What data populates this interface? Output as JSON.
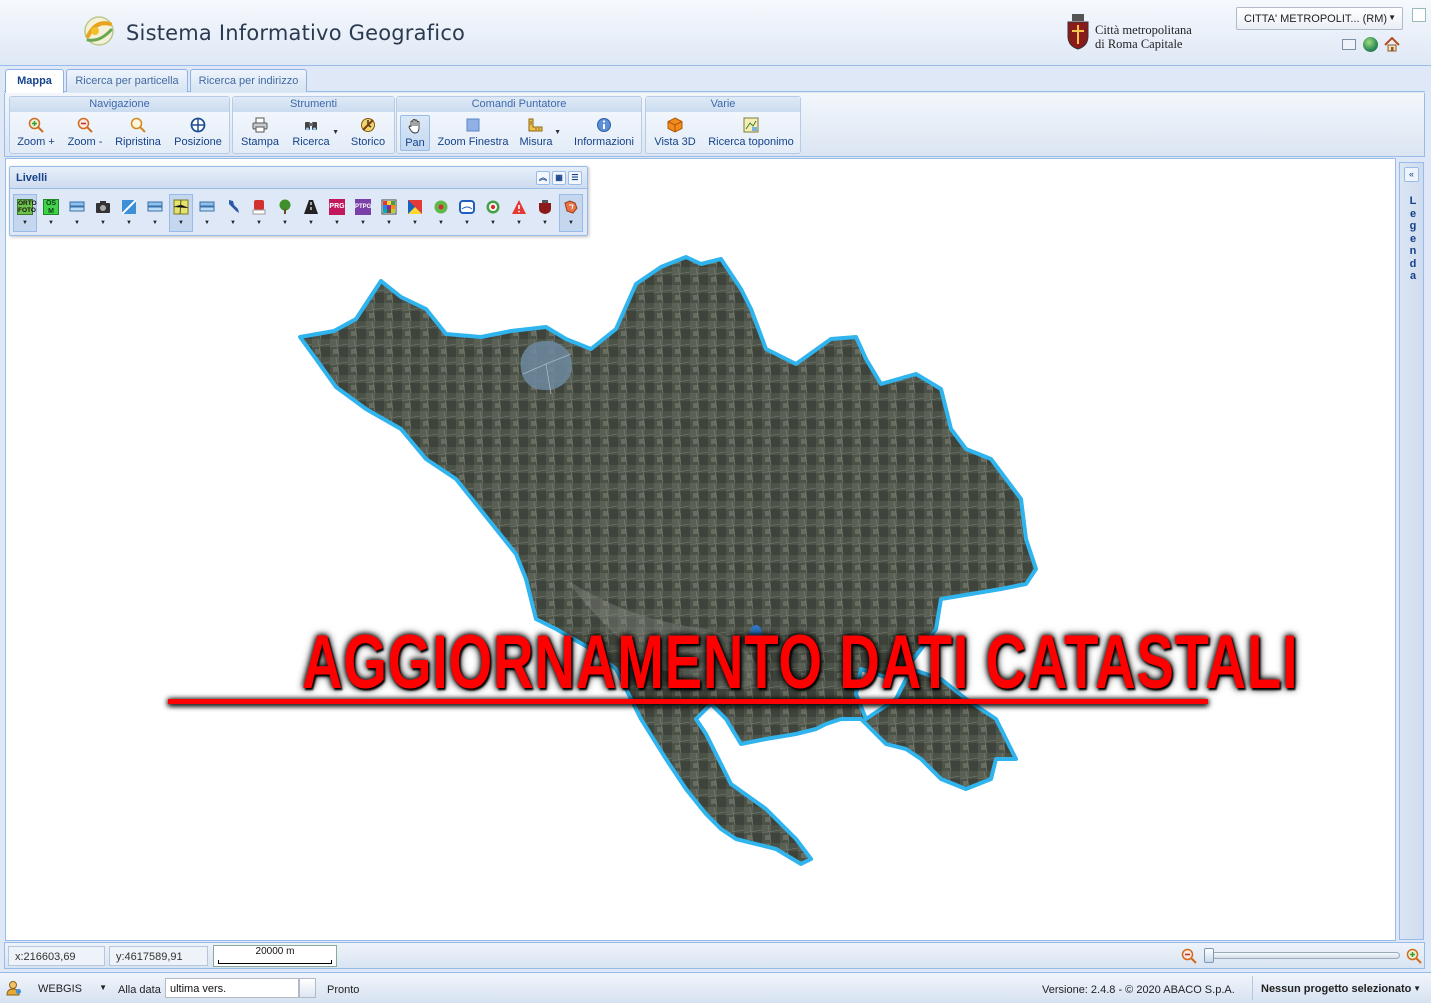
{
  "header": {
    "app_title": "Sistema Informativo Geografico",
    "org_name_line1": "Città metropolitana",
    "org_name_line2": "di Roma Capitale",
    "ente_selected": "CITTA' METROPOLIT... (RM)",
    "icons": [
      "mail-icon",
      "globe-icon",
      "home-icon",
      "maximize-icon"
    ]
  },
  "tabs": [
    {
      "label": "Mappa",
      "active": true
    },
    {
      "label": "Ricerca per particella",
      "active": false
    },
    {
      "label": "Ricerca per indirizzo",
      "active": false
    }
  ],
  "toolbar": {
    "groups": [
      {
        "title": "Navigazione",
        "buttons": [
          "Zoom +",
          "Zoom -",
          "Ripristina",
          "Posizione"
        ]
      },
      {
        "title": "Strumenti",
        "buttons": [
          "Stampa",
          "Ricerca",
          "Storico"
        ]
      },
      {
        "title": "Comandi Puntatore",
        "buttons": [
          "Pan",
          "Zoom Finestra",
          "Misura",
          "Informazioni"
        ]
      },
      {
        "title": "Varie",
        "buttons": [
          "Vista 3D",
          "Ricerca toponimo"
        ]
      }
    ],
    "pressed": "Pan"
  },
  "layers_panel": {
    "title": "Livelli",
    "ortofoto_label": "ORTO FOTO",
    "osm_label": "OS M",
    "prg_label": "PRG",
    "ptpg_label": "PTPG",
    "active_layers": [
      "ortofoto",
      "catasto"
    ]
  },
  "legend": {
    "label": "Legenda"
  },
  "banner": {
    "text": "AGGIORNAMENTO DATI CATASTALI"
  },
  "statusbar": {
    "x_coord": "x:216603,69",
    "y_coord": "y:4617589,91",
    "scale_label": "20000 m",
    "zoom_level": 0.0
  },
  "bottombar": {
    "webgis_menu": "WEBGIS",
    "date_label": "Alla data",
    "date_value": "ultima vers.",
    "status": "Pronto",
    "version": "Versione: 2.4.8 - © 2020 ABACO S.p.A.",
    "project_menu": "Nessun progetto selezionato"
  },
  "colors": {
    "border": "#99bbe8",
    "panel_bg": "#dfe8f6",
    "text": "#15428b",
    "territory_outline": "#36b5f0",
    "banner": "#ff0000"
  }
}
